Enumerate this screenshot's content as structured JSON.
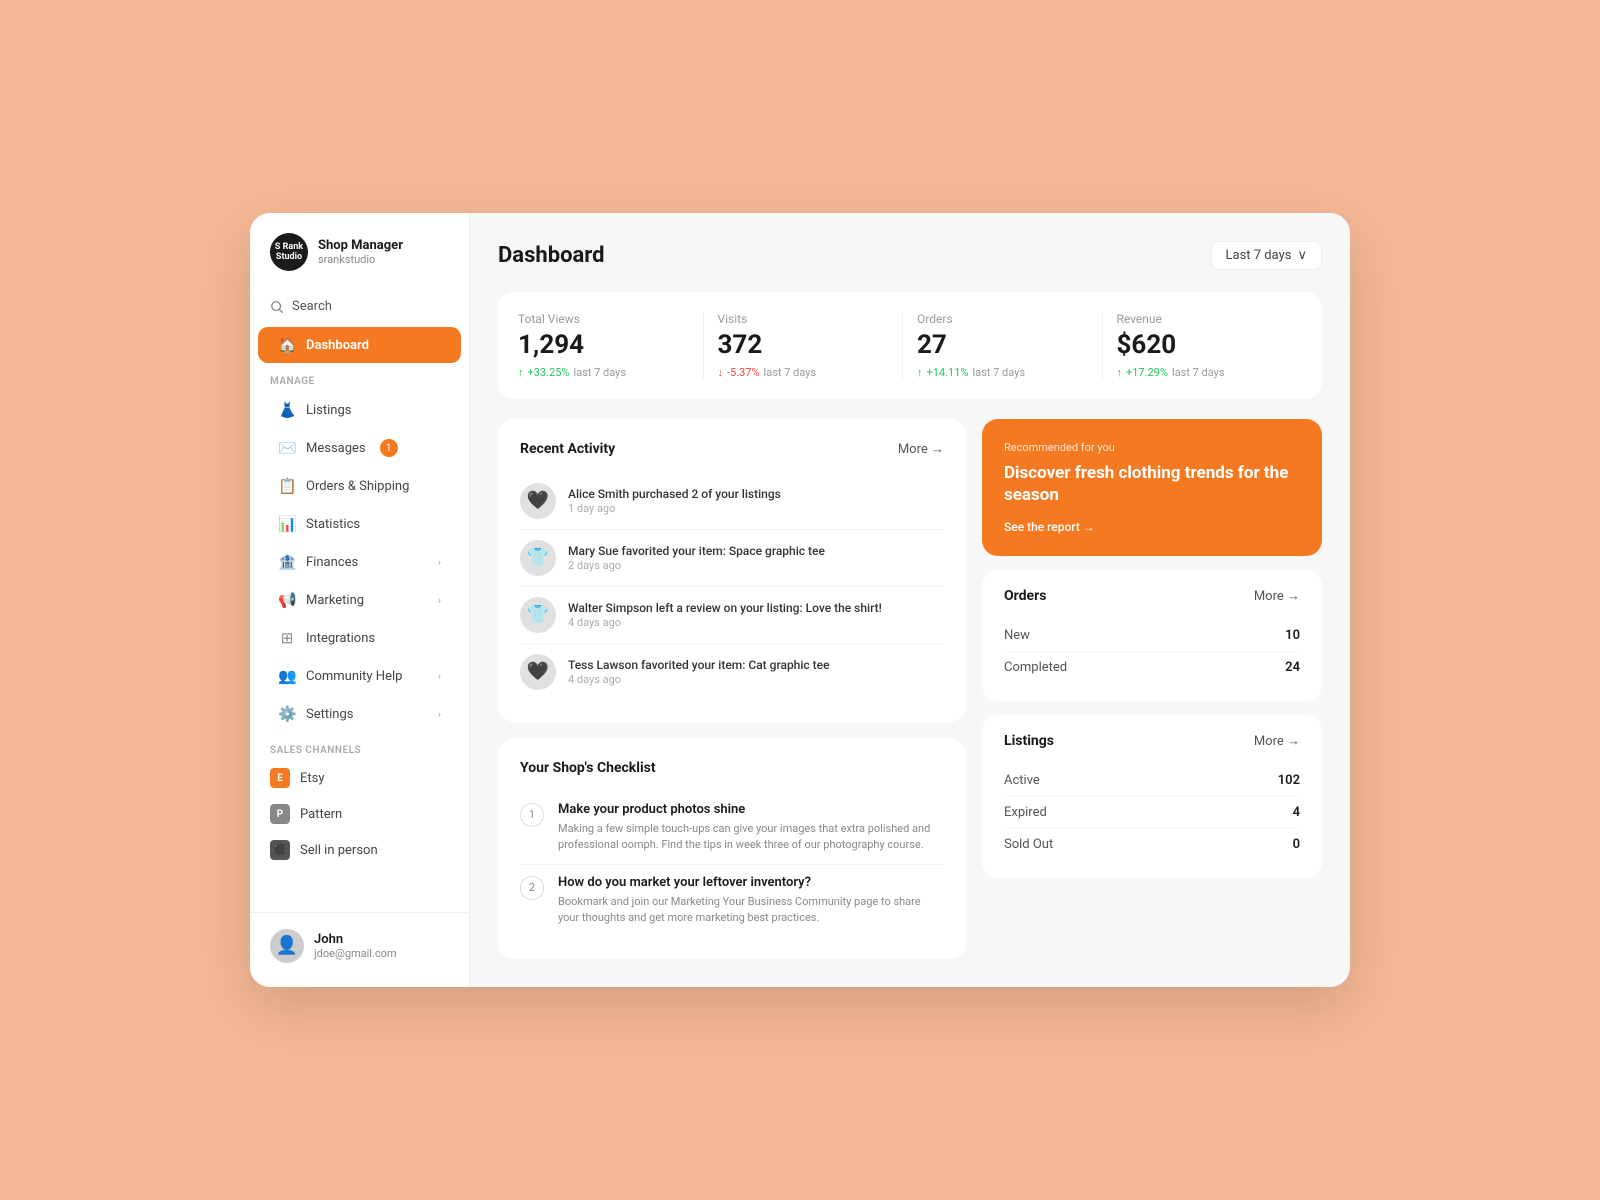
{
  "sidebar": {
    "logo": {
      "text": "S Rank\nStudio",
      "shop_name": "Shop Manager",
      "username": "srankstudio"
    },
    "search_label": "Search",
    "active_item": "Dashboard",
    "manage_label": "Manage",
    "nav_items": [
      {
        "id": "dashboard",
        "label": "Dashboard",
        "icon": "🏠",
        "active": true
      },
      {
        "id": "listings",
        "label": "Listings",
        "icon": "👗",
        "active": false
      },
      {
        "id": "messages",
        "label": "Messages",
        "icon": "✉️",
        "active": false,
        "badge": "1"
      },
      {
        "id": "orders",
        "label": "Orders & Shipping",
        "icon": "📋",
        "active": false
      },
      {
        "id": "statistics",
        "label": "Statistics",
        "icon": "📊",
        "active": false
      },
      {
        "id": "finances",
        "label": "Finances",
        "icon": "🏦",
        "active": false,
        "chevron": true
      },
      {
        "id": "marketing",
        "label": "Marketing",
        "icon": "📢",
        "active": false,
        "chevron": true
      },
      {
        "id": "integrations",
        "label": "Integrations",
        "icon": "⊞",
        "active": false
      },
      {
        "id": "community",
        "label": "Community Help",
        "icon": "👥",
        "active": false,
        "chevron": true
      },
      {
        "id": "settings",
        "label": "Settings",
        "icon": "⚙️",
        "active": false,
        "chevron": true
      }
    ],
    "sales_channels_label": "Sales Channels",
    "channels": [
      {
        "id": "etsy",
        "label": "Etsy",
        "color": "etsy"
      },
      {
        "id": "pattern",
        "label": "Pattern",
        "color": "pattern"
      },
      {
        "id": "person",
        "label": "Sell in person",
        "color": "person"
      }
    ],
    "user": {
      "name": "John",
      "email": "jdoe@gmail.com"
    }
  },
  "main": {
    "title": "Dashboard",
    "date_filter": "Last 7 days",
    "stats": [
      {
        "label": "Total Views",
        "value": "1,294",
        "change": "+33.25%",
        "direction": "up",
        "period": "last 7 days"
      },
      {
        "label": "Visits",
        "value": "372",
        "change": "-5.37%",
        "direction": "down",
        "period": "last 7 days"
      },
      {
        "label": "Orders",
        "value": "27",
        "change": "+14.11%",
        "direction": "up",
        "period": "last 7 days"
      },
      {
        "label": "Revenue",
        "value": "$620",
        "change": "+17.29%",
        "direction": "up",
        "period": "last 7 days"
      }
    ],
    "recent_activity": {
      "title": "Recent Activity",
      "more_label": "More →",
      "items": [
        {
          "desc": "Alice Smith purchased 2 of your listings",
          "time": "1 day ago",
          "avatar": "🖤"
        },
        {
          "desc": "Mary Sue favorited your item: Space graphic tee",
          "time": "2 days ago",
          "avatar": "👕"
        },
        {
          "desc": "Walter Simpson left a review on your listing: Love the shirt!",
          "time": "4 days ago",
          "avatar": "👕"
        },
        {
          "desc": "Tess Lawson favorited your item: Cat graphic tee",
          "time": "4 days ago",
          "avatar": "🖤"
        }
      ]
    },
    "checklist": {
      "title": "Your Shop's Checklist",
      "items": [
        {
          "num": "1",
          "title": "Make your product photos shine",
          "desc": "Making a few simple touch-ups can give your images that extra polished and professional oomph. Find the tips in week three of our photography course."
        },
        {
          "num": "2",
          "title": "How do you market your leftover inventory?",
          "desc": "Bookmark and join our Marketing Your Business Community page to share your thoughts and get more marketing best practices."
        }
      ]
    },
    "recommend": {
      "label": "Recommended for you",
      "title": "Discover fresh clothing trends for the season",
      "link": "See the report →"
    },
    "orders": {
      "title": "Orders",
      "more_label": "More →",
      "rows": [
        {
          "label": "New",
          "value": "10"
        },
        {
          "label": "Completed",
          "value": "24"
        }
      ]
    },
    "listings": {
      "title": "Listings",
      "more_label": "More →",
      "rows": [
        {
          "label": "Active",
          "value": "102"
        },
        {
          "label": "Expired",
          "value": "4"
        },
        {
          "label": "Sold Out",
          "value": "0"
        }
      ]
    }
  }
}
